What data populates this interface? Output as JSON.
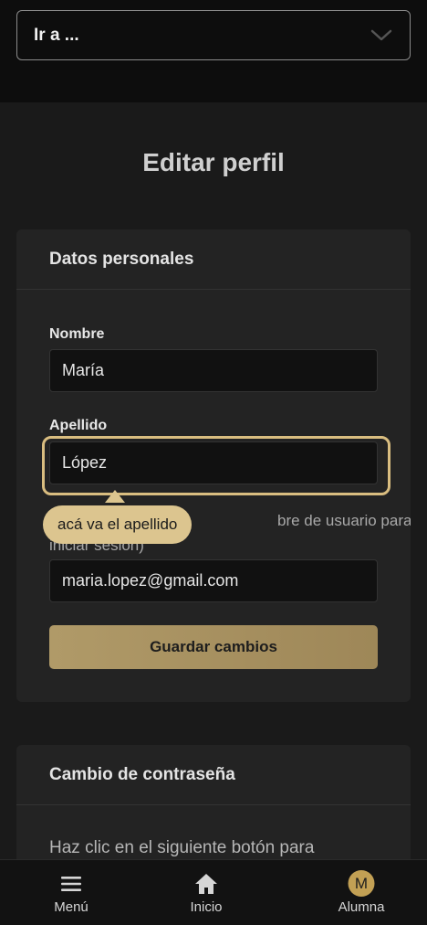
{
  "jump_menu": {
    "label": "Ir a ..."
  },
  "page": {
    "title": "Editar perfil"
  },
  "personal_card": {
    "header": "Datos personales",
    "first_name": {
      "label": "Nombre",
      "value": "María"
    },
    "last_name": {
      "label": "Apellido",
      "value": "López"
    },
    "hint_line1": "bre de usuario para",
    "hint_line2": "iniciar sesión)",
    "email": {
      "value": "maria.lopez@gmail.com"
    },
    "save_label": "Guardar cambios"
  },
  "tooltip": {
    "text": "acá va el apellido"
  },
  "password_card": {
    "header": "Cambio de contraseña",
    "body": "Haz clic en el siguiente botón para"
  },
  "bottom_nav": {
    "menu": "Menú",
    "home": "Inicio",
    "profile": "Alumna",
    "avatar_initial": "M"
  },
  "colors": {
    "accent": "#d9bd80",
    "button": "#b09a68",
    "avatar": "#c2a054"
  }
}
